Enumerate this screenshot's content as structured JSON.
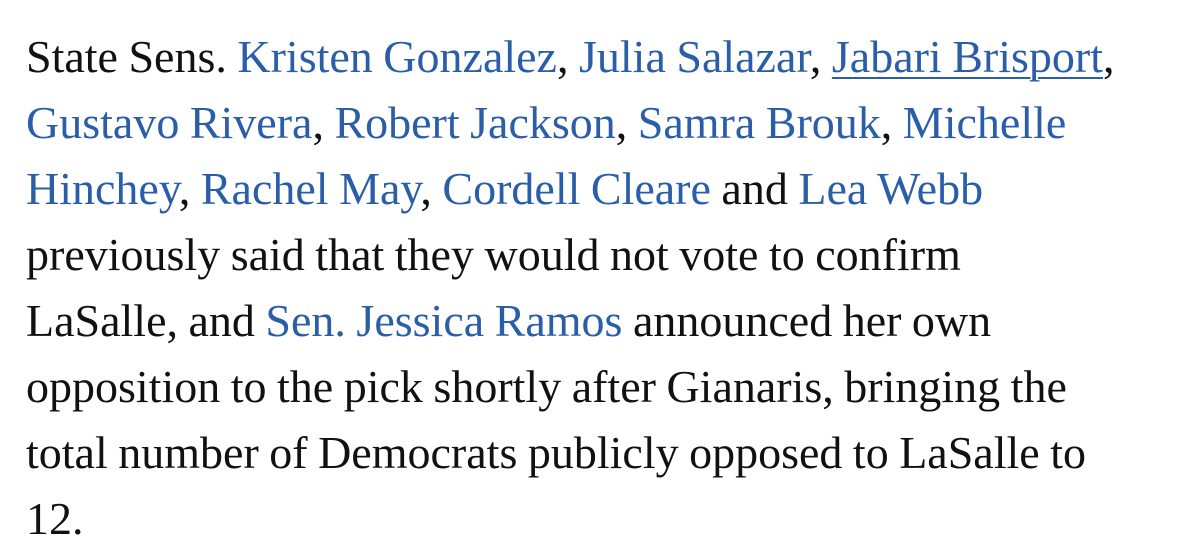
{
  "colors": {
    "text": "#111111",
    "link": "#2a5ea8",
    "background": "#ffffff"
  },
  "article": {
    "intro": "State Sens.",
    "links": [
      "Kristen Gonzalez",
      "Julia Salazar",
      "Jabari Brisport",
      "Gustavo Rivera",
      "Robert Jackson",
      "Samra Brouk",
      "Michelle",
      "Hinchey",
      "Rachel May",
      "Cordell Cleare",
      "Lea Webb",
      "Sen. Jessica Ramos"
    ],
    "and": "and",
    "line4": "previously said that they would not vote to confirm",
    "line5_start": "LaSalle, and",
    "line5_end": "announced her own",
    "line6": "opposition to the pick shortly after Gianaris, bringing the",
    "line7": "total number of Democrats publicly opposed to LaSalle to",
    "line8": "12."
  }
}
